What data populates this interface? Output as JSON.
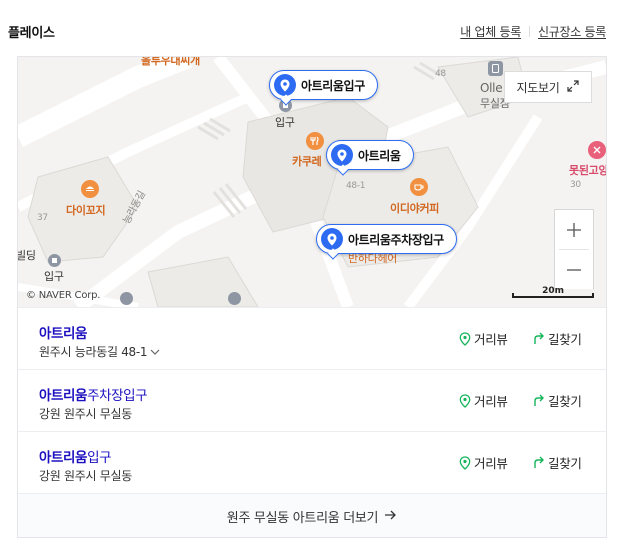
{
  "header": {
    "title": "플레이스",
    "link_register_business": "내 업체 등록",
    "link_register_new_place": "신규장소 등록"
  },
  "map": {
    "labels": {
      "top_orange": "올투우대씨개",
      "entrance_top": "입구",
      "cafe_kakure": "카쿠레",
      "lot_48": "48",
      "lot_48_1": "48-1",
      "olleh_1": "Olle",
      "olleh_2": "무실점",
      "pink_shop": "못된고양",
      "lot_30": "30",
      "idiya": "이디야커피",
      "daikkoji": "다이꼬지",
      "street": "능라동길",
      "lot_37": "37",
      "building": "빌딩",
      "entrance_bottom": "입구",
      "banhada": "반하다헤어"
    },
    "pins": [
      {
        "label": "아트리움입구"
      },
      {
        "label": "아트리움"
      },
      {
        "label": "아트리움주차장입구"
      }
    ],
    "map_view_button": "지도보기",
    "copyright": "© NAVER Corp.",
    "scale": "20m"
  },
  "results": [
    {
      "name_highlight": "아트리움",
      "name_rest": "",
      "address": "원주시 능라동길 48-1",
      "has_dropdown": true,
      "street_view": "거리뷰",
      "directions": "길찾기"
    },
    {
      "name_highlight": "아트리움",
      "name_rest": "주차장입구",
      "address": "강원 원주시 무실동",
      "has_dropdown": false,
      "street_view": "거리뷰",
      "directions": "길찾기"
    },
    {
      "name_highlight": "아트리움",
      "name_rest": "입구",
      "address": "강원 원주시 무실동",
      "has_dropdown": false,
      "street_view": "거리뷰",
      "directions": "길찾기"
    }
  ],
  "more_link": "원주 무실동 아트리움 더보기",
  "colors": {
    "accent_blue": "#2d6cf2",
    "result_title": "#1b0fbf",
    "street_view_green": "#15b55a",
    "map_bg": "#f4f3f1"
  }
}
